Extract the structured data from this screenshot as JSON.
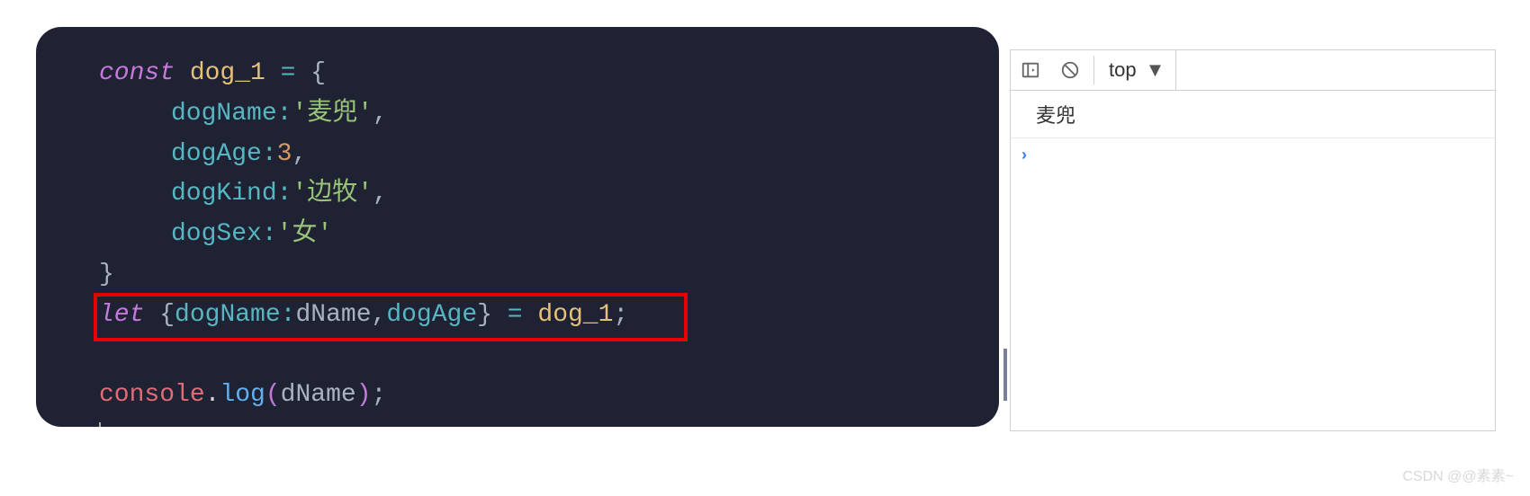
{
  "code": {
    "line1": {
      "kw": "const",
      "name": "dog_1",
      "op": "=",
      "brace": "{"
    },
    "props": {
      "p1": {
        "key": "dogName",
        "val": "'麦兜'",
        "comma": ","
      },
      "p2": {
        "key": "dogAge",
        "val": "3",
        "comma": ","
      },
      "p3": {
        "key": "dogKind",
        "val": "'边牧'",
        "comma": ","
      },
      "p4": {
        "key": "dogSex",
        "val": "'女'"
      }
    },
    "closebrace": "}",
    "destruct": {
      "kw": "let",
      "open": "{",
      "k1": "dogName",
      "colon": ":",
      "a1": "dName",
      "comma": ",",
      "k2": "dogAge",
      "close": "}",
      "op": "=",
      "rhs": "dog_1",
      "semi": ";"
    },
    "log": {
      "obj": "console",
      "dot": ".",
      "method": "log",
      "open": "(",
      "arg": "dName",
      "close": ")",
      "semi": ";"
    }
  },
  "devtools": {
    "scope": "top",
    "output": "麦兜",
    "prompt": "›"
  },
  "watermark": "CSDN @@素素~"
}
